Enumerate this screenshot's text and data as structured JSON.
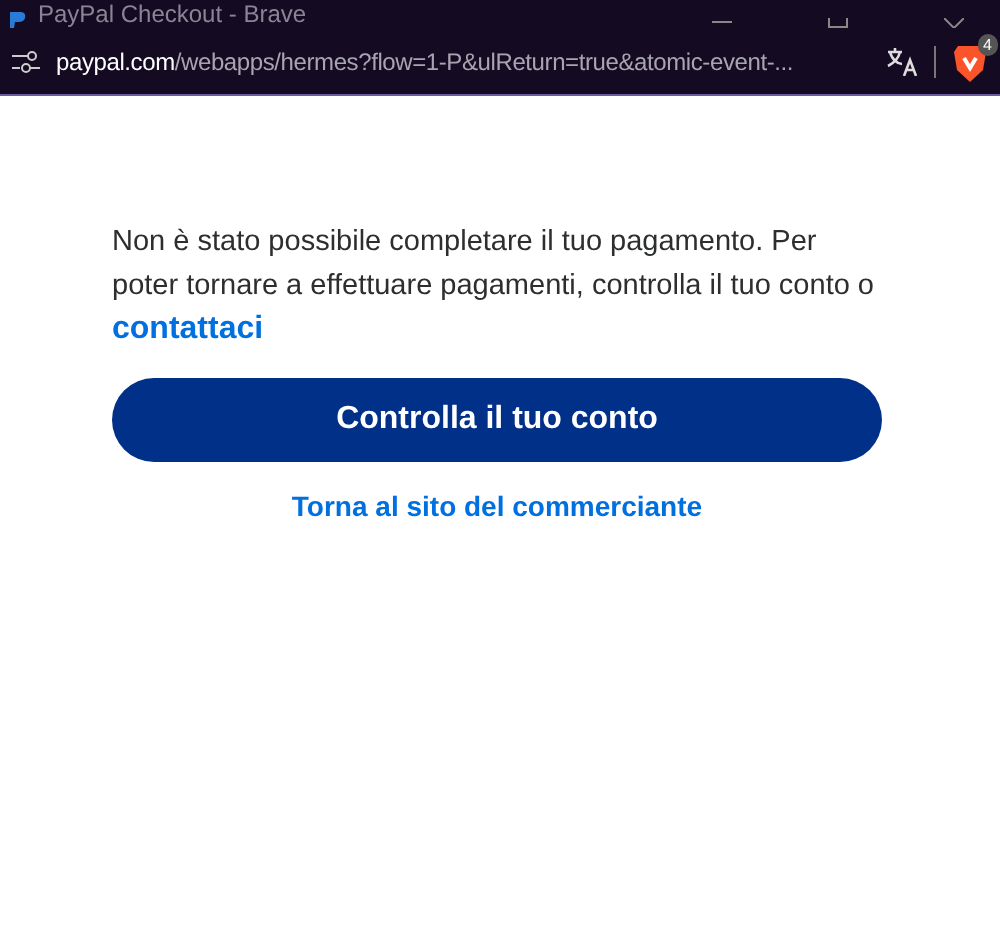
{
  "window": {
    "title": "PayPal Checkout - Brave"
  },
  "address_bar": {
    "host": "paypal.com",
    "path": "/webapps/hermes?flow=1-P&ulReturn=true&atomic-event-...",
    "shield_badge": "4"
  },
  "message": {
    "text": "Non è stato possibile completare il tuo pagamento. Per poter tornare a effettuare pagamenti, controlla il tuo conto o",
    "link": "contattaci"
  },
  "primary_button": "Controlla il tuo conto",
  "secondary_link": "Torna al sito del commerciante"
}
